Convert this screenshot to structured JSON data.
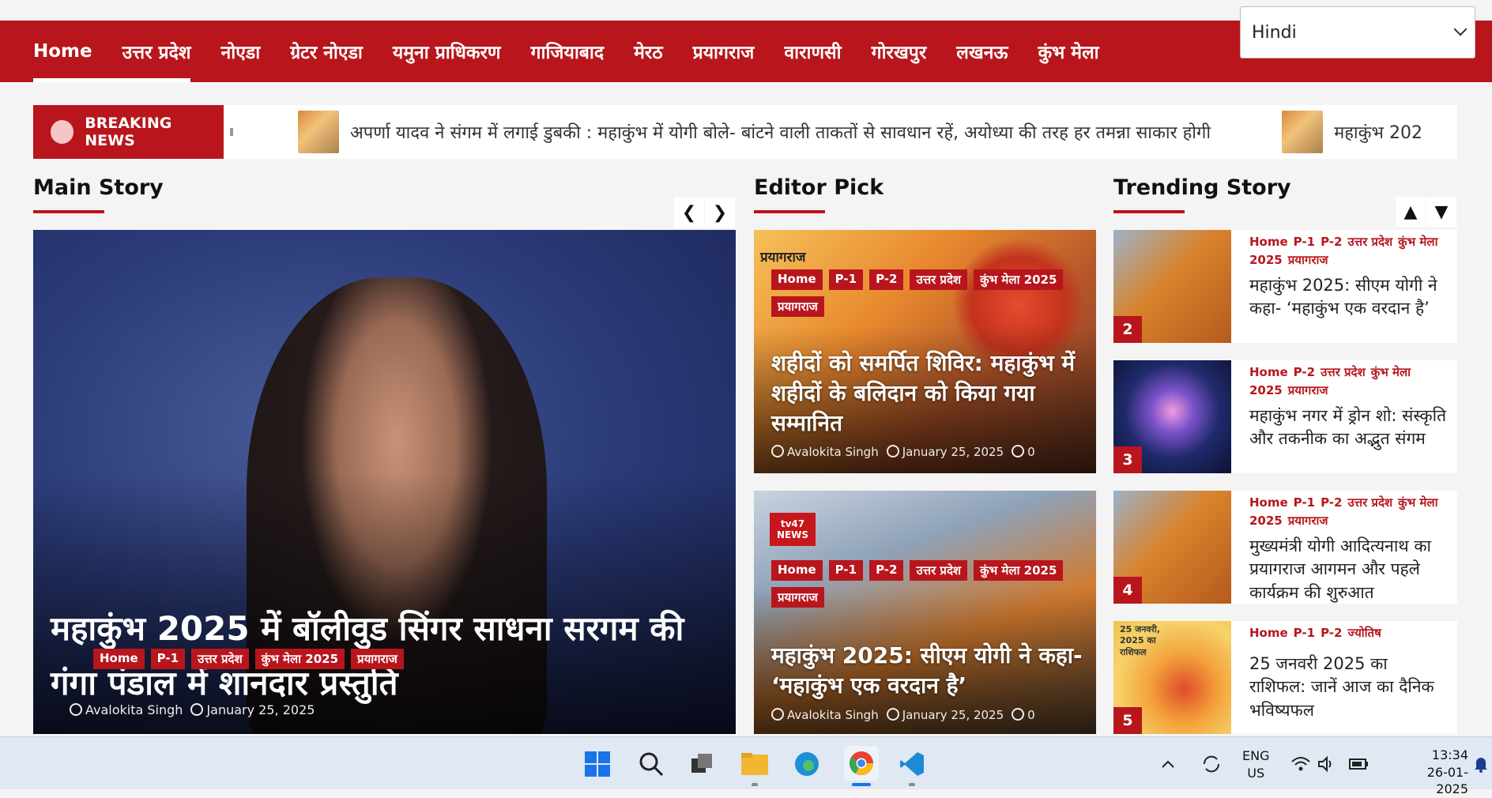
{
  "nav": {
    "items": [
      "Home",
      "उत्तर प्रदेश",
      "नोएडा",
      "ग्रेटर नोएडा",
      "यमुना प्राधिकरण",
      "गाजियाबाद",
      "मेरठ",
      "प्रयागराज",
      "वाराणसी",
      "गोरखपुर",
      "लखनऊ",
      "कुंभ मेला"
    ],
    "language": "Hindi"
  },
  "ticker": {
    "label": "BREAKING NEWS",
    "items": [
      "अपर्णा यादव ने संगम में लगाई डुबकी : महाकुंभ में योगी बोले- बांटने वाली ताकतों से सावधान रहें, अयोध्या की तरह हर तमन्ना साकार होगी",
      "महाकुंभ 202"
    ]
  },
  "main_story": {
    "section_title": "Main Story",
    "title": "महाकुंभ 2025 में बॉलीवुड सिंगर साधना सरगम की गंगा पंडाल में शानदार प्रस्तुति",
    "tags": [
      "Home",
      "P-1",
      "उत्तर प्रदेश",
      "कुंभ मेला 2025",
      "प्रयागराज"
    ],
    "author": "Avalokita Singh",
    "date": "January 25, 2025"
  },
  "editor_pick": {
    "section_title": "Editor Pick",
    "cards": [
      {
        "overlay_text": "प्रयागराज",
        "tags": [
          "Home",
          "P-1",
          "P-2",
          "उत्तर प्रदेश",
          "कुंभ मेला 2025",
          "प्रयागराज"
        ],
        "title": "शहीदों को समर्पित शिविर: महाकुंभ में शहीदों के बलिदान को किया गया सम्मानित",
        "author": "Avalokita Singh",
        "date": "January 25, 2025",
        "comments": "0"
      },
      {
        "logo_text": "tv47 NEWS",
        "tags": [
          "Home",
          "P-1",
          "P-2",
          "उत्तर प्रदेश",
          "कुंभ मेला 2025",
          "प्रयागराज"
        ],
        "title": "महाकुंभ 2025: सीएम योगी ने कहा- ‘महाकुंभ एक वरदान है’",
        "author": "Avalokita Singh",
        "date": "January 25, 2025",
        "comments": "0"
      }
    ]
  },
  "trending": {
    "section_title": "Trending Story",
    "items": [
      {
        "rank": "2",
        "tags": [
          "Home",
          "P-1",
          "P-2",
          "उत्तर प्रदेश",
          "कुंभ मेला 2025",
          "प्रयागराज"
        ],
        "title": "महाकुंभ 2025: सीएम योगी ने कहा- ‘महाकुंभ एक वरदान है’"
      },
      {
        "rank": "3",
        "tags": [
          "Home",
          "P-2",
          "उत्तर प्रदेश",
          "कुंभ मेला 2025",
          "प्रयागराज"
        ],
        "title": "महाकुंभ नगर में ड्रोन शो: संस्कृति और तकनीक का अद्भुत संगम"
      },
      {
        "rank": "4",
        "tags": [
          "Home",
          "P-1",
          "P-2",
          "उत्तर प्रदेश",
          "कुंभ मेला 2025",
          "प्रयागराज"
        ],
        "title": "मुख्यमंत्री योगी आदित्यनाथ का प्रयागराज आगमन और पहले कार्यक्रम की शुरुआत"
      },
      {
        "rank": "5",
        "tags": [
          "Home",
          "P-1",
          "P-2",
          "ज्योतिष"
        ],
        "title": "25 जनवरी 2025 का राशिफल: जानें आज का दैनिक भविष्यफल",
        "img_text": "25 जनवरी, 2025 का राशिफल"
      }
    ]
  },
  "taskbar": {
    "lang": "ENG",
    "region": "US",
    "time": "13:34",
    "date": "26-01-2025"
  },
  "colors": {
    "brand": "#b8161c",
    "taskbar": "#dfe8f3"
  }
}
